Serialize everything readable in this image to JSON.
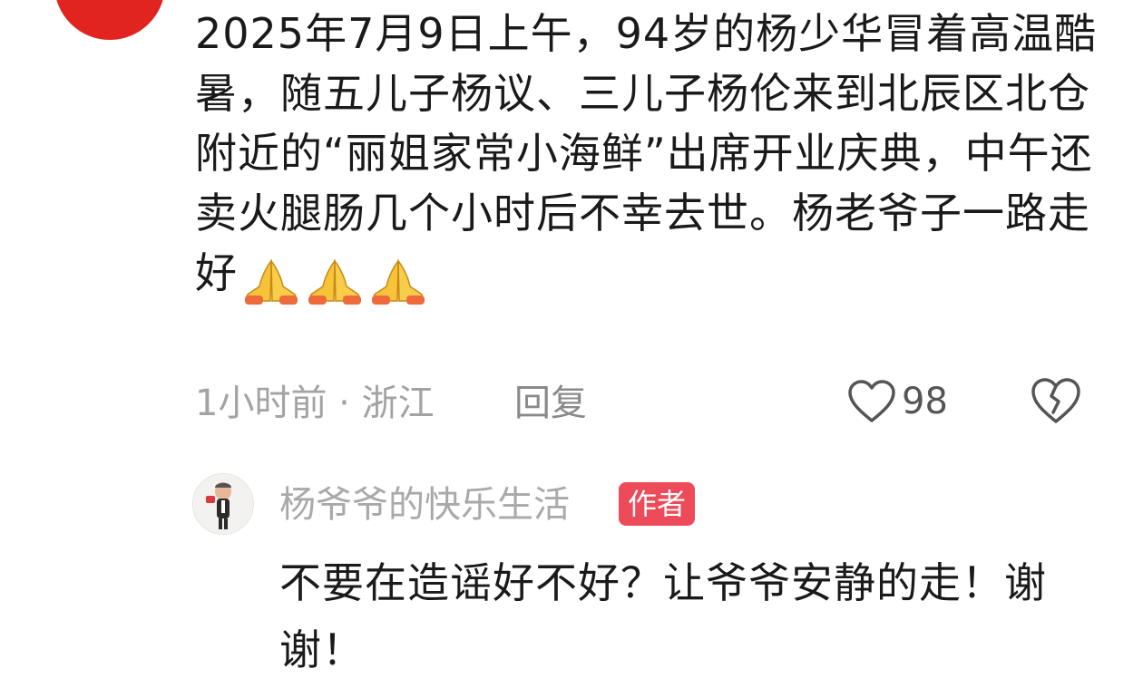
{
  "comment": {
    "text": "2025年7月9日上午，94岁的杨少华冒着高温酷暑，随五儿子杨议、三儿子杨伦来到北辰区北仓附近的“丽姐家常小海鲜”出席开业庆典，中午还卖火腿肠几个小时后不幸去世。杨老爷子一路走好",
    "emoji": [
      "folded-hands",
      "folded-hands",
      "folded-hands"
    ],
    "time": "1小时前",
    "separator": "·",
    "location": "浙江",
    "reply_label": "回复",
    "like_count": "98"
  },
  "reply": {
    "author_name": "杨爷爷的快乐生活",
    "badge": "作者",
    "text": "不要在造谣好不好？让爷爷安静的走！谢谢！"
  },
  "colors": {
    "avatar_red": "#e1241f",
    "badge_bg": "#ee4b5a",
    "text_main": "#1a1a1a",
    "text_meta": "#a3a3a3"
  }
}
